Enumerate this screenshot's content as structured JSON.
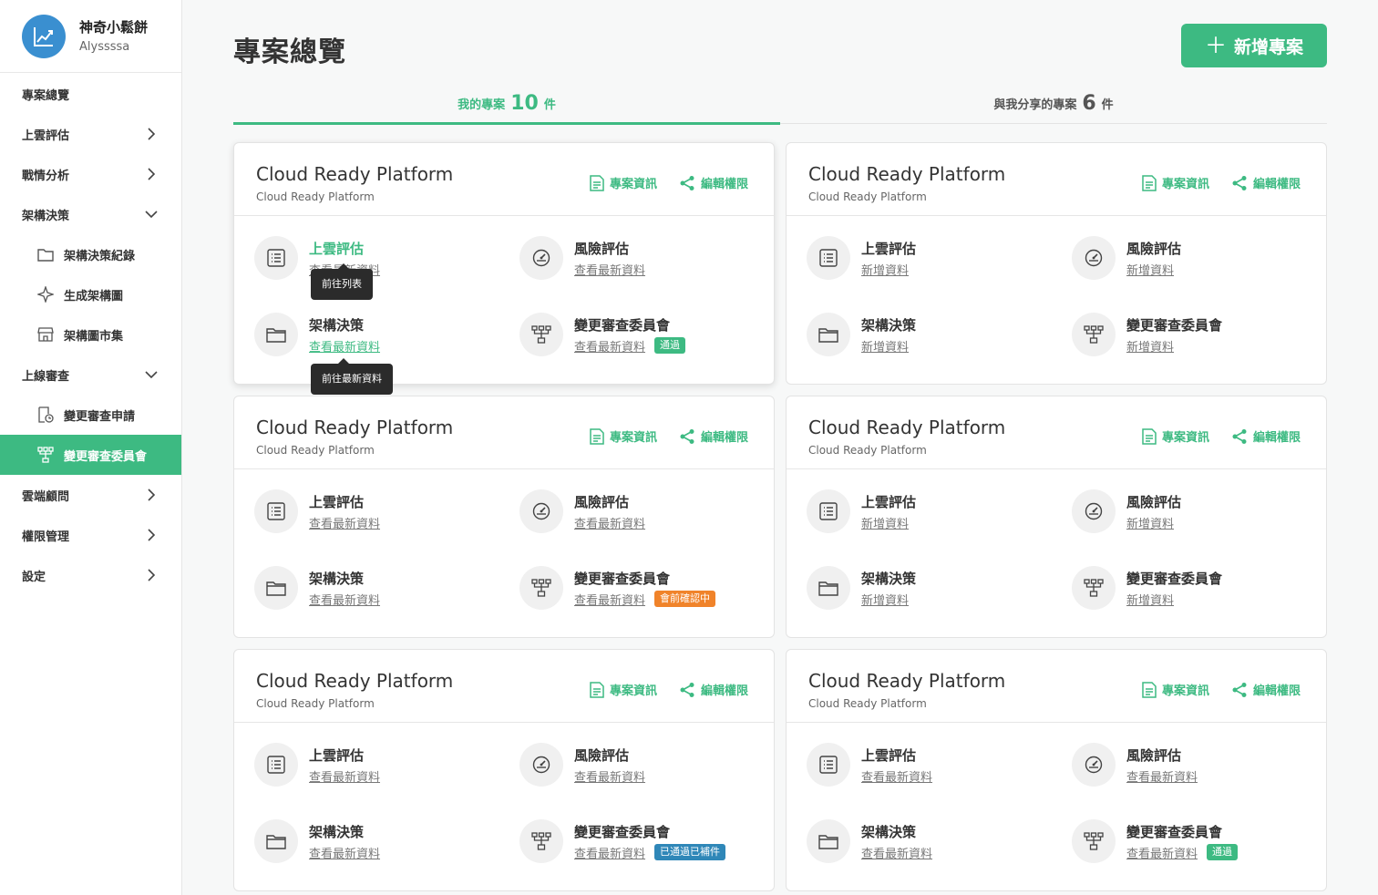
{
  "profile": {
    "name": "神奇小鬆餅",
    "username": "Alyssssa"
  },
  "sidebar": {
    "items": [
      {
        "label": "專案總覽"
      },
      {
        "label": "上雲評估"
      },
      {
        "label": "戰情分析"
      },
      {
        "label": "架構決策"
      },
      {
        "label": "架構決策紀錄"
      },
      {
        "label": "生成架構圖"
      },
      {
        "label": "架構圖市集"
      },
      {
        "label": "上線審查"
      },
      {
        "label": "變更審查申請"
      },
      {
        "label": "變更審查委員會"
      },
      {
        "label": "雲端顧問"
      },
      {
        "label": "權限管理"
      },
      {
        "label": "設定"
      }
    ]
  },
  "header": {
    "title": "專案總覽",
    "add_label": "新增專案"
  },
  "tabs": [
    {
      "label": "我的專案",
      "count": "10",
      "unit": "件"
    },
    {
      "label": "與我分享的專案",
      "count": "6",
      "unit": "件"
    }
  ],
  "card_labels": {
    "info": "專案資訊",
    "perm": "編輯權限",
    "assess": "上雲評估",
    "risk": "風險評估",
    "arch": "架構決策",
    "cab": "變更審查委員會"
  },
  "cards": [
    {
      "title": "Cloud Ready Platform",
      "subtitle": "Cloud Ready Platform",
      "links": [
        "查看最新資料",
        "查看最新資料",
        "查看最新資料",
        "查看最新資料"
      ],
      "badge": "通過"
    },
    {
      "title": "Cloud Ready Platform",
      "subtitle": "Cloud Ready Platform",
      "links": [
        "新增資料",
        "新增資料",
        "新增資料",
        "新增資料"
      ],
      "badge": ""
    },
    {
      "title": "Cloud Ready Platform",
      "subtitle": "Cloud Ready Platform",
      "links": [
        "查看最新資料",
        "查看最新資料",
        "查看最新資料",
        "查看最新資料"
      ],
      "badge": "會前確認中"
    },
    {
      "title": "Cloud Ready Platform",
      "subtitle": "Cloud Ready Platform",
      "links": [
        "新增資料",
        "新增資料",
        "新增資料",
        "新增資料"
      ],
      "badge": ""
    },
    {
      "title": "Cloud Ready Platform",
      "subtitle": "Cloud Ready Platform",
      "links": [
        "查看最新資料",
        "查看最新資料",
        "查看最新資料",
        "查看最新資料"
      ],
      "badge": "已通過已補件"
    },
    {
      "title": "Cloud Ready Platform",
      "subtitle": "Cloud Ready Platform",
      "links": [
        "查看最新資料",
        "查看最新資料",
        "查看最新資料",
        "查看最新資料"
      ],
      "badge": "通過"
    }
  ],
  "tooltips": {
    "list": "前往列表",
    "latest": "前往最新資料"
  },
  "colors": {
    "accent": "#3dba82",
    "pending": "#f0832a",
    "supplemented": "#2f87b8"
  }
}
